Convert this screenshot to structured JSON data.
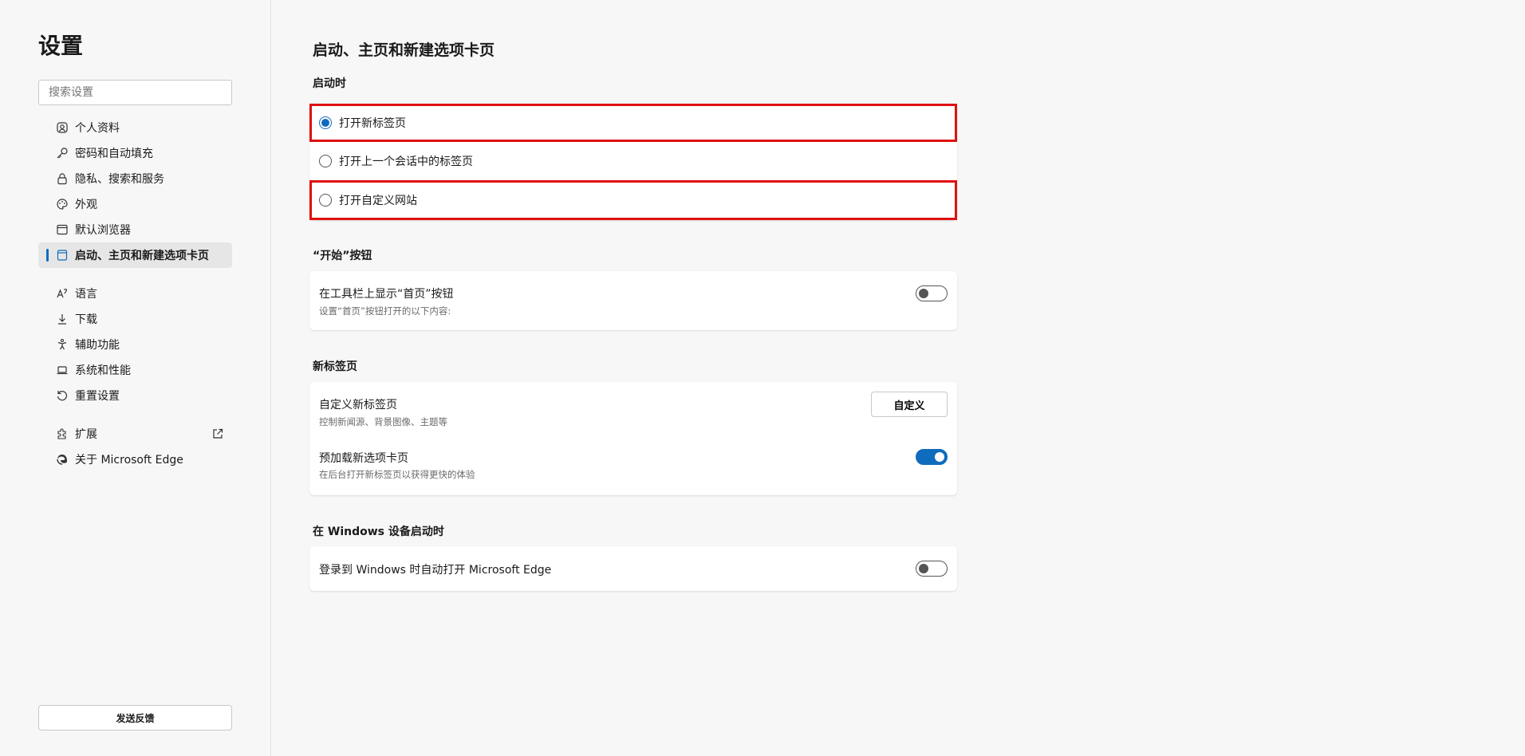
{
  "sidebar": {
    "title": "设置",
    "search_placeholder": "搜索设置",
    "items": [
      {
        "label": "个人资料",
        "icon": "profile-icon"
      },
      {
        "label": "密码和自动填充",
        "icon": "key-icon"
      },
      {
        "label": "隐私、搜索和服务",
        "icon": "lock-icon"
      },
      {
        "label": "外观",
        "icon": "palette-icon"
      },
      {
        "label": "默认浏览器",
        "icon": "browser-icon"
      },
      {
        "label": "启动、主页和新建选项卡页",
        "icon": "home-page-icon"
      },
      {
        "label": "语言",
        "icon": "language-icon"
      },
      {
        "label": "下载",
        "icon": "download-icon"
      },
      {
        "label": "辅助功能",
        "icon": "accessibility-icon"
      },
      {
        "label": "系统和性能",
        "icon": "laptop-icon"
      },
      {
        "label": "重置设置",
        "icon": "reset-icon"
      },
      {
        "label": "扩展",
        "icon": "extension-icon"
      },
      {
        "label": "关于 Microsoft Edge",
        "icon": "edge-icon"
      }
    ],
    "feedback_label": "发送反馈"
  },
  "main": {
    "title": "启动、主页和新建选项卡页",
    "startup": {
      "label": "启动时",
      "options": [
        {
          "label": "打开新标签页",
          "checked": true
        },
        {
          "label": "打开上一个会话中的标签页",
          "checked": false
        },
        {
          "label": "打开自定义网站",
          "checked": false
        }
      ]
    },
    "home_button": {
      "label": "“开始”按钮",
      "title": "在工具栏上显示“首页”按钮",
      "subtitle": "设置“首页”按钮打开的以下内容:",
      "enabled": false
    },
    "new_tab": {
      "label": "新标签页",
      "customize_title": "自定义新标签页",
      "customize_subtitle": "控制新闻源、背景图像、主题等",
      "customize_button": "自定义",
      "preload_title": "预加载新选项卡页",
      "preload_subtitle": "在后台打开新标签页以获得更快的体验",
      "preload_enabled": true
    },
    "windows_startup": {
      "label": "在 Windows 设备启动时",
      "title": "登录到 Windows 时自动打开 Microsoft Edge",
      "enabled": false
    }
  },
  "colors": {
    "accent": "#0f6cbd",
    "highlight_border": "#e01010"
  }
}
